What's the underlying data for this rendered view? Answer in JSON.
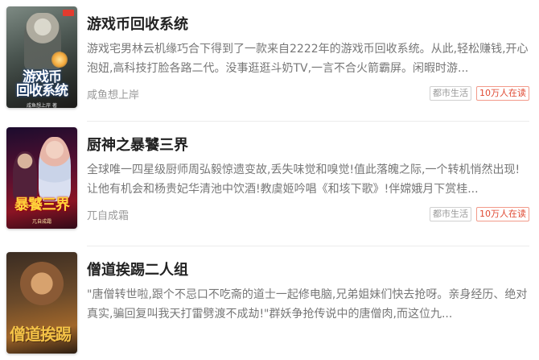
{
  "books": [
    {
      "title": "游戏币回收系统",
      "cover_title_lines": [
        "游戏币",
        "回收系统"
      ],
      "cover_sub": "咸鱼想上岸 著",
      "desc": "游戏宅男林云机缘巧合下得到了一款来自2222年的游戏币回收系统。从此,轻松赚钱,开心泡妞,高科技打脸各路二代。没事逛逛斗奶TV,一言不合火箭霸屏。闲暇时游...",
      "author": "咸鱼想上岸",
      "category": "都市生活",
      "readers": "10万人在读"
    },
    {
      "title": "厨神之暴饕三界",
      "cover_title_lines": [
        "暴饕三界"
      ],
      "cover_sub": "兀自成霜",
      "desc": "全球唯一四星级厨师周弘毅惊遗变故,丢失味觉和嗅觉!值此落魄之际,一个转机悄然出现!让他有机会和杨贵妃华清池中饮酒!教虞姬吟唱《和垓下歌》!伴嫦娥月下赏桂...",
      "author": "兀自成霜",
      "category": "都市生活",
      "readers": "10万人在读"
    },
    {
      "title": "僧道挨踢二人组",
      "cover_title_lines": [
        "僧道挨踢"
      ],
      "cover_sub": "",
      "desc": "\"唐僧转世啦,跟个不忌口不吃斋的道士一起修电脑,兄弟姐妹们快去抢呀。亲身经历、绝对真实,骗回复叫我天打雷劈渡不成劫!\"群妖争抢传说中的唐僧肉,而这位九...",
      "author": "",
      "category": "",
      "readers": ""
    }
  ],
  "colors": {
    "title": "#222222",
    "desc": "#777777",
    "hot_tag": "#e04a33"
  }
}
